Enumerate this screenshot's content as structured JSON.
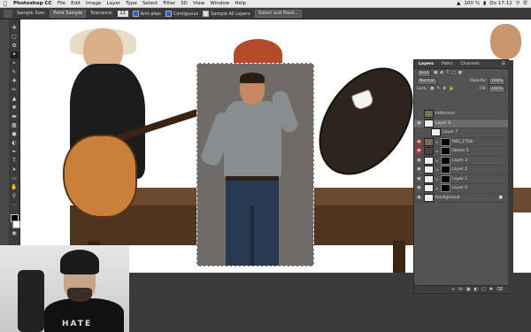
{
  "menubar": {
    "items": [
      "Photoshop CC",
      "File",
      "Edit",
      "Image",
      "Layer",
      "Type",
      "Select",
      "Filter",
      "3D",
      "View",
      "Window",
      "Help"
    ],
    "battery": "100 %",
    "clock": "Do 17:12"
  },
  "options": {
    "sample_size_label": "Sample Size:",
    "sample_size_value": "Point Sample",
    "tolerance_label": "Tolerance:",
    "tolerance_value": "12",
    "anti_alias": "Anti-alias",
    "contiguous": "Contiguous",
    "sample_all": "Sample All Layers",
    "select_mask": "Select and Mask..."
  },
  "layers_panel": {
    "tabs": [
      "Layers",
      "Paths",
      "Channels"
    ],
    "kind": "Kind",
    "blend_mode": "Normal",
    "opacity_label": "Opacity:",
    "opacity_value": "100%",
    "lock_label": "Lock:",
    "fill_label": "Fill:",
    "fill_value": "100%",
    "layers": [
      {
        "name": "reference"
      },
      {
        "name": "Layer 9"
      },
      {
        "name": "Layer 7"
      },
      {
        "name": "IMG_2708"
      },
      {
        "name": "Ebene 5"
      },
      {
        "name": "Layer 3"
      },
      {
        "name": "Layer 2"
      },
      {
        "name": "Layer 1"
      },
      {
        "name": "Layer 0"
      },
      {
        "name": "Background"
      }
    ]
  },
  "webcam": {
    "shirt_text": "HATE"
  }
}
